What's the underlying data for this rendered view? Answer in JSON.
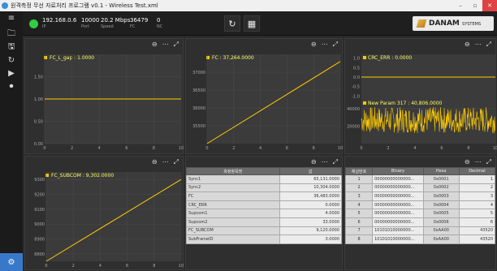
{
  "window": {
    "title": "원격측정 무선 자료처리 프로그램 v0.1 - Wireless Test.xml"
  },
  "status": {
    "ip": "192.168.0.6",
    "ip_label": "IP",
    "port": "10000",
    "port_label": "Port",
    "speed": "20.2 Mbps",
    "speed_label": "Speed",
    "fc": "36479",
    "fc_label": "FC",
    "nc": "0",
    "nc_label": "NC"
  },
  "logo": {
    "name": "DANAM",
    "suffix": "SYSTEMS"
  },
  "panels": {
    "p1": {
      "title": "FC_L_gap : 1.0000"
    },
    "p2": {
      "title": "FC : 37,264.0000"
    },
    "p3": {
      "title": "CRC_ERR : 0.0000",
      "title2": "New Param 317 : 40,806.0000"
    },
    "p4": {
      "title": "FC_SUBCOM : 9,302.0000"
    }
  },
  "chart_data": [
    {
      "type": "line",
      "title": "FC_L_gap : 1.0000",
      "x": [
        0,
        10
      ],
      "series": [
        {
          "values": [
            1.0,
            1.0
          ]
        }
      ],
      "xlim": [
        0,
        10
      ],
      "ylim": [
        0,
        2
      ],
      "yticks": [
        "0.00",
        "0.50",
        "1.00",
        "1.50"
      ],
      "xticks": [
        "0",
        "2",
        "4",
        "6",
        "8",
        "10"
      ]
    },
    {
      "type": "line",
      "title": "FC : 37,264.0000",
      "x": [
        0,
        10
      ],
      "series": [
        {
          "values": [
            35000,
            37300
          ]
        }
      ],
      "xlim": [
        0,
        10
      ],
      "yticks": [
        "35500",
        "36000",
        "36500",
        "37000"
      ],
      "xticks": [
        "0",
        "2",
        "4",
        "6",
        "8",
        "10"
      ]
    },
    {
      "type": "line",
      "title": "CRC_ERR : 0.0000",
      "x": [
        0,
        10
      ],
      "series": [
        {
          "values": [
            0,
            0
          ]
        }
      ],
      "xlim": [
        0,
        10
      ],
      "yticks": [
        "1.0",
        "0.5",
        "0.0",
        "-0.5",
        "-1.0"
      ]
    },
    {
      "type": "line",
      "title": "New Param 317 : 40,806.0000",
      "xlim": [
        0,
        10
      ],
      "yticks": [
        "20000",
        "40000"
      ],
      "xticks": [
        "0",
        "2",
        "4",
        "6",
        "8",
        "10"
      ]
    },
    {
      "type": "line",
      "title": "FC_SUBCOM : 9,302.0000",
      "x": [
        0,
        10
      ],
      "series": [
        {
          "values": [
            8750,
            9300
          ]
        }
      ],
      "xlim": [
        0,
        10
      ],
      "yticks": [
        "8800",
        "8900",
        "9000",
        "9100",
        "9200",
        "9300"
      ],
      "xticks": [
        "0",
        "2",
        "4",
        "6",
        "8",
        "10"
      ]
    }
  ],
  "measure_table": {
    "headers": [
      "측정항목명",
      "값"
    ],
    "rows": [
      [
        "Sync1",
        "65,131.0000"
      ],
      [
        "Sync2",
        "10,304.0000"
      ],
      [
        "FC",
        "36,483.0000"
      ],
      [
        "CRC_ERR",
        "0.0000"
      ],
      [
        "Supcom1",
        "4.0000"
      ],
      [
        "Supcom2",
        "33.0000"
      ],
      [
        "FC_SUBCOM",
        "9,120.0000"
      ],
      [
        "SubFrameID",
        "3.0000"
      ]
    ]
  },
  "channel_table": {
    "headers": [
      "채널번호",
      "Binary",
      "Hexa",
      "Decimal"
    ],
    "rows": [
      [
        "1",
        "00000000000000...",
        "0x0001",
        "1"
      ],
      [
        "2",
        "00000000000000...",
        "0x0002",
        "2"
      ],
      [
        "3",
        "00000000000000...",
        "0x0003",
        "3"
      ],
      [
        "4",
        "00000000000000...",
        "0x0004",
        "4"
      ],
      [
        "5",
        "00000000000000...",
        "0x0005",
        "5"
      ],
      [
        "6",
        "00000000000000...",
        "0x0006",
        "6"
      ],
      [
        "7",
        "10101010000000...",
        "0xAA00",
        "43520"
      ],
      [
        "8",
        "10101010000000...",
        "0xAA00",
        "43520"
      ]
    ]
  }
}
